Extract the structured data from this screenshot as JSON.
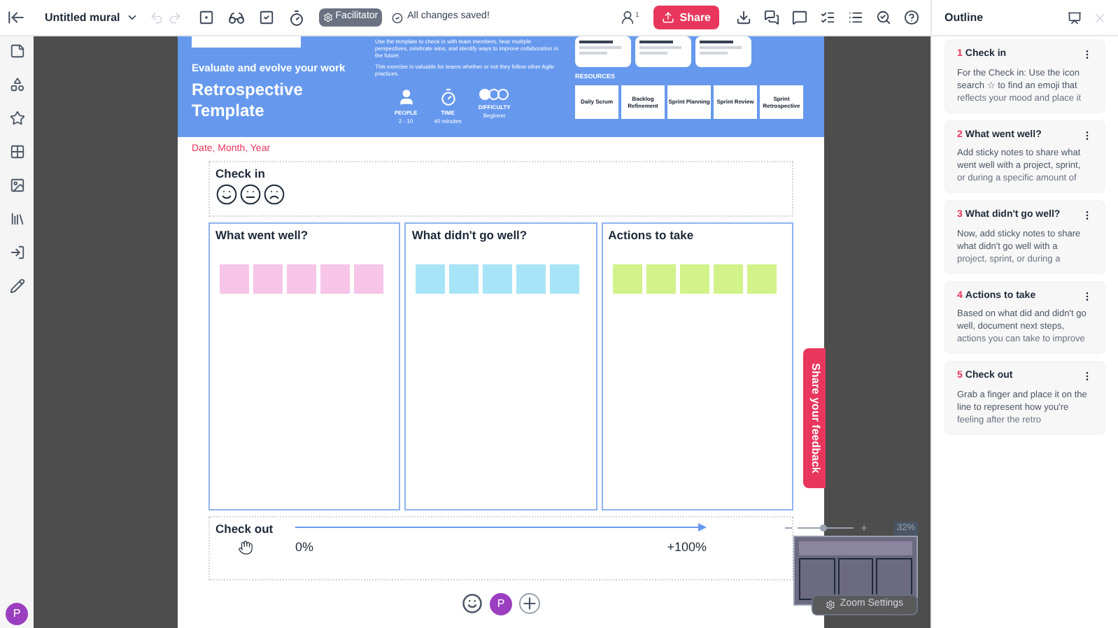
{
  "toolbar": {
    "title": "Untitled mural",
    "facilitator": "Facilitator",
    "save_status": "All changes saved!",
    "collaborators": "1",
    "share": "Share"
  },
  "board": {
    "banner": {
      "tagline": "Evaluate and evolve your work",
      "title": "Retrospective Template",
      "description": [
        "Use the template to check in with team members, hear multiple perspectives, celebrate wins, and identify ways to improve collaboration in the future.",
        "This exercise is valuable for teams whether or not they follow other Agile practices."
      ],
      "stats": [
        {
          "kind": "people",
          "label": "PEOPLE",
          "value": "2 - 10"
        },
        {
          "kind": "time",
          "label": "TIME",
          "value": "40 minutes"
        },
        {
          "kind": "difficulty",
          "label": "DIFFICULTY",
          "value": "Beginner"
        }
      ],
      "resources_heading": "RESOURCES",
      "resources": [
        "Daily Scrum",
        "Backlog Refinement",
        "Sprint Planning",
        "Sprint Review",
        "Sprint Retrospective"
      ]
    },
    "date": "Date, Month, Year",
    "check_in": {
      "title": "Check in"
    },
    "columns": [
      {
        "title": "What went well?",
        "color": "#f6c5e8"
      },
      {
        "title": "What didn't go well?",
        "color": "#a8e4f7"
      },
      {
        "title": "Actions to take",
        "color": "#d2f28a"
      }
    ],
    "check_out": {
      "title": "Check out",
      "start": "0%",
      "end": "+100%"
    },
    "user": "P"
  },
  "feedback_tab": "Share your feedback",
  "zoom": {
    "level": 0.45,
    "reading": "32%",
    "settings": "Zoom Settings"
  },
  "sidebar_user": "P",
  "outline": {
    "title": "Outline",
    "items": [
      {
        "number": "1",
        "title": "Check in",
        "description": "For the Check in: Use the icon search ☆ to find an emoji that",
        "faded": "reflects your mood and place it"
      },
      {
        "number": "2",
        "title": "What went well?",
        "description": "Add sticky notes to share what went well with a project, sprint,",
        "faded": "or during a specific amount of"
      },
      {
        "number": "3",
        "title": "What didn't go well?",
        "description": "Now, add sticky notes to share what didn't go well with a",
        "faded": "project, sprint, or during a"
      },
      {
        "number": "4",
        "title": "Actions to take",
        "description": "Based on what did and didn't go well, document next steps,",
        "faded": "actions you can take to improve"
      },
      {
        "number": "5",
        "title": "Check out",
        "description": "Grab a finger and place it on the line to represent how you're",
        "faded": "feeling after the retro"
      }
    ]
  }
}
